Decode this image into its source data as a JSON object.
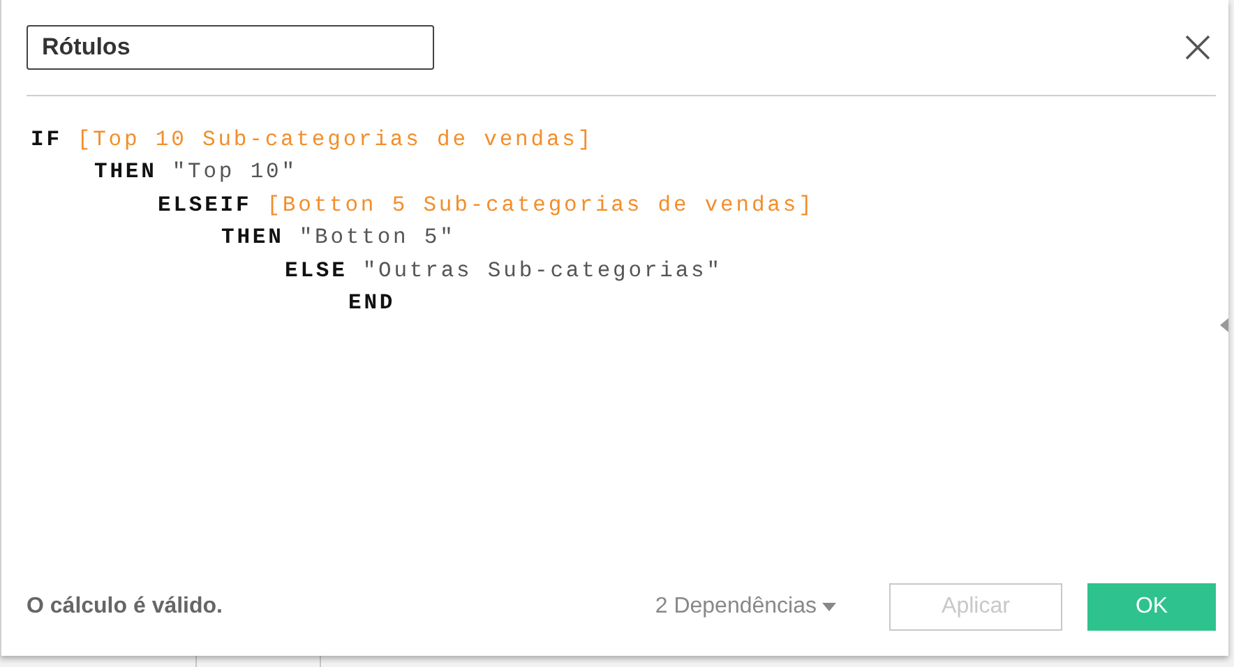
{
  "dialog": {
    "name_field": {
      "value": "Rótulos"
    },
    "code": [
      {
        "tokens": [
          {
            "kind": "keyword",
            "text": "IF"
          },
          {
            "kind": "field",
            "text": "[Top 10 Sub-categorias de vendas]"
          }
        ],
        "children": [
          {
            "tokens": [
              {
                "kind": "keyword",
                "text": "THEN"
              },
              {
                "kind": "string",
                "text": "\"Top 10\""
              }
            ],
            "children": [
              {
                "tokens": [
                  {
                    "kind": "keyword",
                    "text": "ELSEIF"
                  },
                  {
                    "kind": "field",
                    "text": "[Botton 5 Sub-categorias de vendas]"
                  }
                ],
                "children": [
                  {
                    "tokens": [
                      {
                        "kind": "keyword",
                        "text": "THEN"
                      },
                      {
                        "kind": "string",
                        "text": "\"Botton 5\""
                      }
                    ],
                    "children": [
                      {
                        "tokens": [
                          {
                            "kind": "keyword",
                            "text": "ELSE"
                          },
                          {
                            "kind": "string",
                            "text": "\"Outras Sub-categorias\""
                          }
                        ],
                        "children": [
                          {
                            "tokens": [
                              {
                                "kind": "keyword",
                                "text": "END"
                              }
                            ]
                          }
                        ]
                      }
                    ]
                  }
                ]
              }
            ]
          }
        ]
      }
    ],
    "status": "O cálculo é válido.",
    "dependencies": "2 Dependências",
    "buttons": [
      {
        "label": "Aplicar",
        "disabled": true
      },
      {
        "label": "OK",
        "disabled": false
      }
    ]
  }
}
